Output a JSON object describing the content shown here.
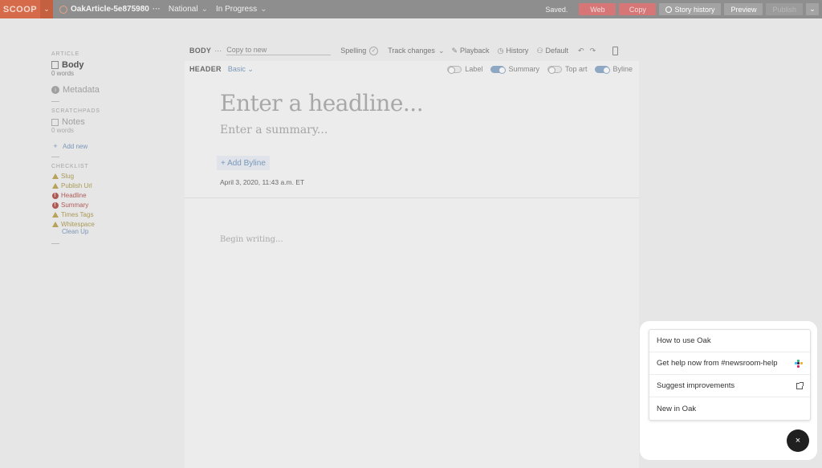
{
  "topbar": {
    "logo": "SCOOP",
    "slug": "OakArticle-5e875980",
    "slug_dots": "···",
    "desk": "National",
    "status": "In Progress",
    "saved": "Saved.",
    "web_label": "Web",
    "copy_label": "Copy",
    "story_history_label": "Story history",
    "preview_label": "Preview",
    "publish_label": "Publish"
  },
  "sidebar": {
    "article_section": "ARTICLE",
    "body_title": "Body",
    "body_words": "0 words",
    "metadata_label": "Metadata",
    "scratchpads_section": "SCRATCHPADS",
    "notes_label": "Notes",
    "notes_sub": "0 words",
    "add_new_label": "Add new",
    "checklist_section": "CHECKLIST",
    "checklist": [
      {
        "label": "Slug",
        "level": "warning"
      },
      {
        "label": "Publish Url",
        "level": "warning"
      },
      {
        "label": "Headline",
        "level": "error"
      },
      {
        "label": "Summary",
        "level": "error"
      },
      {
        "label": "Times Tags",
        "level": "warning"
      },
      {
        "label": "Whitespace",
        "level": "warning"
      }
    ],
    "clean_up_label": "Clean Up"
  },
  "editor_toolbar": {
    "body_label": "BODY",
    "dots": "···",
    "copy_to_new_placeholder": "Copy to new",
    "spelling_label": "Spelling",
    "track_changes_label": "Track changes",
    "playback_label": "Playback",
    "history_label": "History",
    "default_label": "Default"
  },
  "editor": {
    "header_label": "HEADER",
    "header_style": "Basic",
    "toggles": [
      {
        "label": "Label",
        "on": false
      },
      {
        "label": "Summary",
        "on": true
      },
      {
        "label": "Top art",
        "on": false
      },
      {
        "label": "Byline",
        "on": true
      }
    ],
    "headline_placeholder": "Enter a headline...",
    "summary_placeholder": "Enter a summary...",
    "add_byline_label": "+ Add Byline",
    "dateline": "April 3, 2020, 11:43 a.m. ET",
    "body_placeholder": "Begin writing..."
  },
  "help_panel": {
    "items": [
      {
        "label": "How to use Oak",
        "icon": ""
      },
      {
        "label": "Get help now from #newsroom-help",
        "icon": "slack-icon"
      },
      {
        "label": "Suggest improvements",
        "icon": "external-link-icon"
      },
      {
        "label": "New in Oak",
        "icon": ""
      }
    ],
    "close_symbol": "×"
  },
  "colors": {
    "topbar": "#8e8e8e",
    "logo": "#d56b4b",
    "accent_red": "#d77676",
    "link_blue": "#7a97b8",
    "close_button": "#1f1f1f"
  }
}
